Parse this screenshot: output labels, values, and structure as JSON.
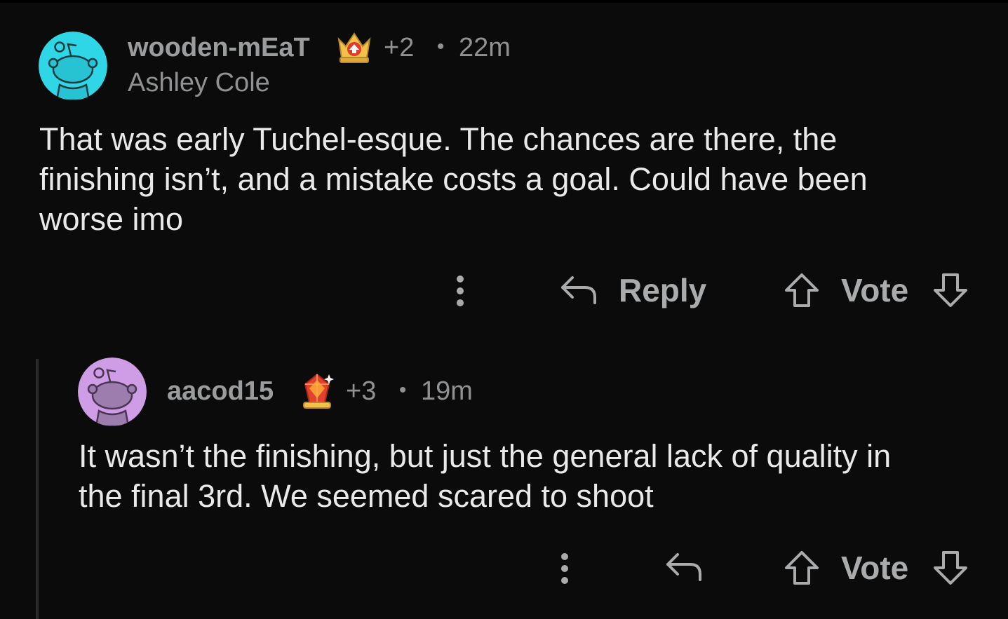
{
  "colors": {
    "background": "#0b0b0b",
    "text_primary": "#e9e9e9",
    "text_secondary": "#8f9193",
    "avatar_cyan": "#2fd6e6",
    "avatar_purple": "#cf9de6"
  },
  "comments": [
    {
      "username": "wooden-mEaT",
      "award": "crown-award-icon",
      "votes": "+2",
      "separator": "•",
      "time": "22m",
      "flair": "Ashley Cole",
      "body_lines": [
        "That was early Tuchel-esque. The chances are there, the",
        "finishing isn’t, and a mistake costs a goal. Could have been",
        "worse imo"
      ],
      "actions": {
        "more": "more-options-icon",
        "reply_label": "Reply",
        "vote_label": "Vote"
      }
    },
    {
      "username": "aacod15",
      "award": "gem-award-icon",
      "votes": "+3",
      "separator": "•",
      "time": "19m",
      "body_lines": [
        "It wasn’t the finishing, but just the general lack of quality in",
        "the final 3rd. We seemed scared to shoot"
      ],
      "actions": {
        "more": "more-options-icon",
        "vote_label": "Vote"
      }
    }
  ]
}
